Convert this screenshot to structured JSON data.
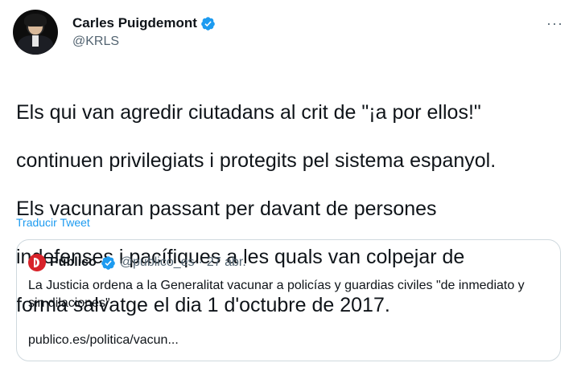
{
  "author": {
    "display_name": "Carles Puigdemont",
    "handle": "@KRLS"
  },
  "tweet": {
    "text_lines": [
      "Els qui van agredir ciutadans al crit de \"¡a por ellos!\"",
      "continuen privilegiats i protegits pel sistema espanyol.",
      "Els vacunaran passant per davant de persones",
      "indefenses i pacífiques a les quals van colpejar de",
      "forma salvatge el dia 1 d'octubre de 2017."
    ],
    "translate_label": "Traducir Tweet"
  },
  "quote": {
    "display_name": "Público",
    "handle": "@publico_es",
    "separator": "·",
    "date": "27 abr.",
    "text": "La Justicia ordena a la Generalitat vacunar a policías y guardias civiles \"de inmediato y sin dilaciones\"",
    "link": "publico.es/politica/vacun..."
  },
  "icons": {
    "verified": "verified-badge-icon",
    "more": "more-options-icon",
    "quote_logo": "publico-logo-icon"
  },
  "colors": {
    "accent": "#1d9bf0",
    "text": "#0f1419",
    "secondary": "#536471",
    "border": "#cfd9de",
    "publico_red": "#d8232a"
  }
}
